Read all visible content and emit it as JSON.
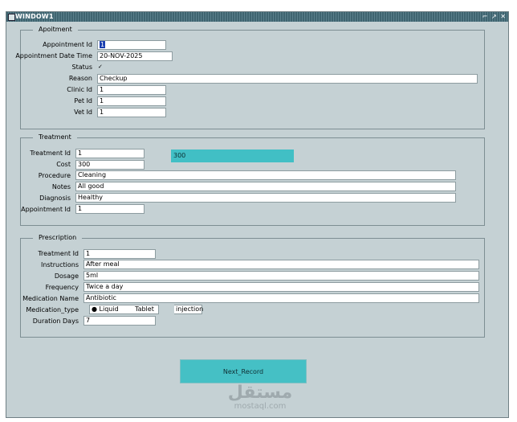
{
  "window": {
    "title": "WINDOW1",
    "controls": [
      "⌐",
      "↗",
      "✕"
    ]
  },
  "appointment": {
    "legend": "Apoitment",
    "labels": {
      "appointment_id": "Appointment Id",
      "date_time": "Appointment Date Time",
      "status": "Status",
      "reason": "Reason",
      "clinic_id": "Clinic Id",
      "pet_id": "Pet Id",
      "vet_id": "Vet Id"
    },
    "values": {
      "appointment_id": "1",
      "date_time": "20-NOV-2025",
      "status_checked": "✓",
      "reason": "Checkup",
      "clinic_id": "1",
      "pet_id": "1",
      "vet_id": "1"
    }
  },
  "treatment": {
    "legend": "Treatment",
    "labels": {
      "treatment_id": "Treatment Id",
      "cost": "Cost",
      "procedure": "Procedure",
      "notes": "Notes",
      "diagnosis": "Diagnosis",
      "appointment_id": "Appointment Id"
    },
    "values": {
      "treatment_id": "1",
      "highlight": "300",
      "cost": "300",
      "procedure": "Cleaning",
      "notes": "All good",
      "diagnosis": "Healthy",
      "appointment_id": "1"
    }
  },
  "prescription": {
    "legend": "Prescription",
    "labels": {
      "treatment_id": "Treatment Id",
      "instructions": "Instructions",
      "dosage": "Dosage",
      "frequency": "Frequency",
      "medication_name": "Medication Name",
      "medication_type": "Medication_type",
      "duration_days": "Duration Days"
    },
    "values": {
      "treatment_id": "1",
      "instructions": "After meal",
      "dosage": "5ml",
      "frequency": "Twice a day",
      "medication_name": "Antibiotic",
      "duration_days": "7"
    },
    "medication_options": [
      {
        "label": "Liquid",
        "selected": true
      },
      {
        "label": "Tablet",
        "selected": false
      },
      {
        "label": "injection",
        "selected": false
      }
    ]
  },
  "buttons": {
    "next_record": "Next_Record"
  },
  "watermark": {
    "logo": "مستقل",
    "url": "mostaql.com"
  },
  "colors": {
    "window_bg": "#c5d1d4",
    "titlebar": "#3f6470",
    "accent_teal": "#41bfc5"
  }
}
